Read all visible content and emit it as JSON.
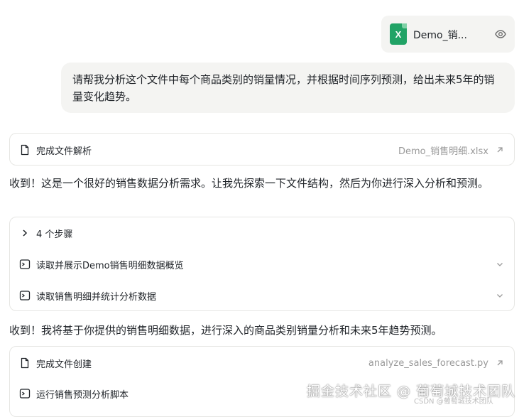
{
  "attachment": {
    "file_name": "Demo_销..."
  },
  "user_message": "请帮我分析这个文件中每个商品类别的销量情况，并根据时间序列预测，给出未来5年的销量变化趋势。",
  "parse_card": {
    "label": "完成文件解析",
    "file": "Demo_销售明细.xlsx"
  },
  "reply_1": "收到！这是一个很好的销售数据分析需求。让我先探索一下文件结构，然后为你进行深入分析和预测。",
  "steps_card": {
    "header": "4 个步骤",
    "items": [
      {
        "label": "读取并展示Demo销售明细数据概览"
      },
      {
        "label": "读取销售明细并统计分析数据"
      }
    ]
  },
  "reply_2": "收到！我将基于你提供的销售明细数据，进行深入的商品类别销量分析和未来5年趋势预测。",
  "create_card": {
    "label": "完成文件创建",
    "file": "analyze_sales_forecast.py",
    "run_label": "运行销售预测分析脚本"
  },
  "watermark": {
    "main": "掘金技术社区 @ 葡萄城技术团队",
    "sub": "CSDN @葡萄城技术团队"
  }
}
